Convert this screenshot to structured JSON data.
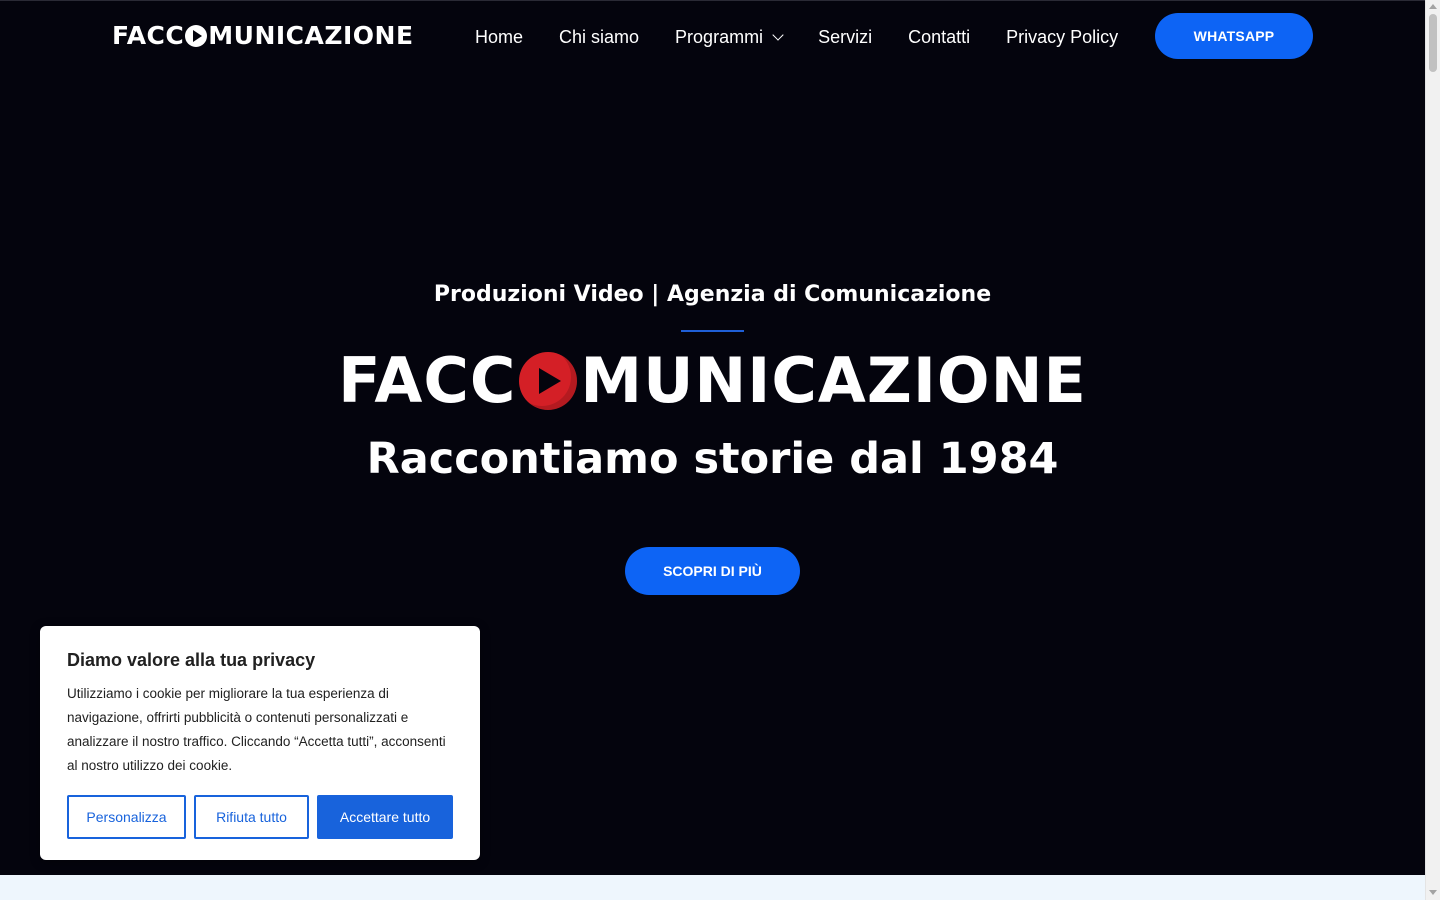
{
  "header": {
    "logo_text_left": "FACC",
    "logo_text_right": "MUNICAZIONE",
    "nav": [
      {
        "label": "Home"
      },
      {
        "label": "Chi siamo"
      },
      {
        "label": "Programmi"
      },
      {
        "label": "Servizi"
      },
      {
        "label": "Contatti"
      },
      {
        "label": "Privacy Policy"
      }
    ],
    "whatsapp_label": "WHATSAPP"
  },
  "hero": {
    "subtitle": "Produzioni Video | Agenzia di Comunicazione",
    "logo_text_left": "FACC",
    "logo_text_right": "MUNICAZIONE",
    "tagline": "Raccontiamo storie dal 1984",
    "cta_label": "SCOPRI DI PIÙ"
  },
  "cookie_banner": {
    "title": "Diamo valore alla tua privacy",
    "text": "Utilizziamo i cookie per migliorare la tua esperienza di navigazione, offrirti pubblicità o contenuti personalizzati e analizzare il nostro traffico. Cliccando “Accetta tutti”, acconsenti al nostro utilizzo dei cookie.",
    "btn_customize": "Personalizza",
    "btn_reject": "Rifiuta tutto",
    "btn_accept": "Accettare tutto"
  },
  "colors": {
    "background": "#04040d",
    "accent_blue": "#0d64f5",
    "cookie_blue": "#1863dc",
    "logo_red": "#d41f26"
  },
  "icons": {
    "logo_play": "play-circle-icon",
    "dropdown": "chevron-down-icon"
  }
}
